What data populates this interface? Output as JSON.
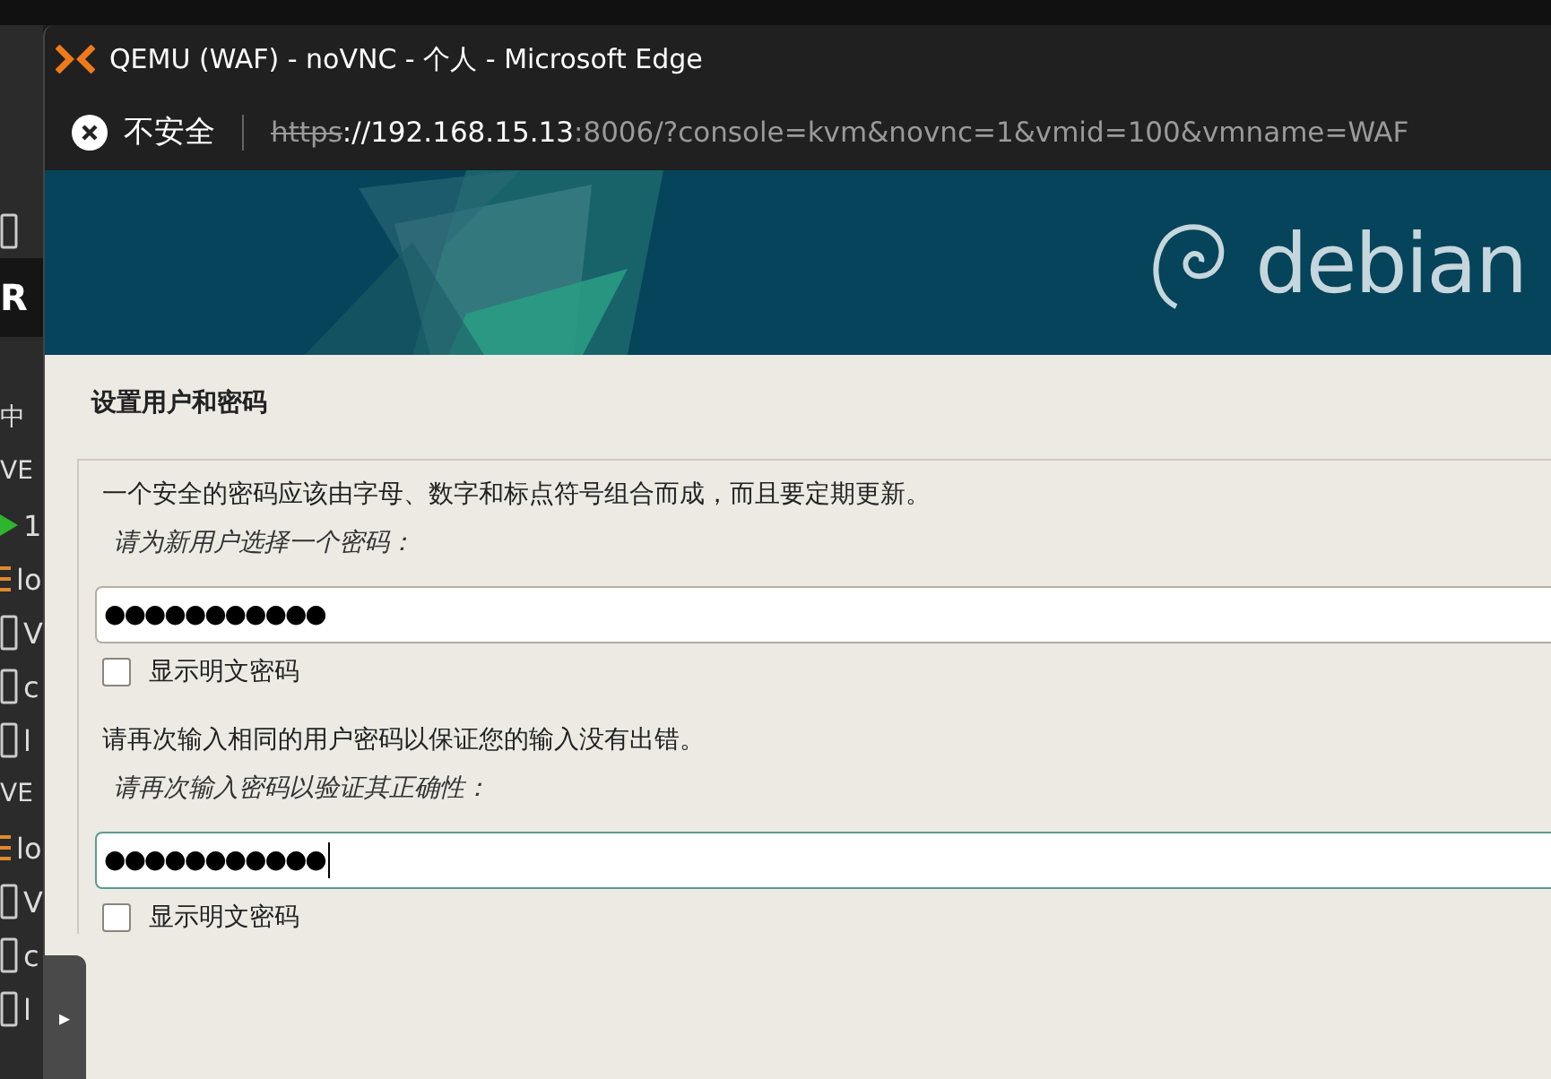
{
  "background_window": {
    "items": [
      {
        "kind": "node"
      },
      {
        "kind": "logo",
        "text": "R"
      },
      {
        "kind": "text"
      },
      {
        "kind": "text",
        "text": "中"
      },
      {
        "kind": "text",
        "text": "VE"
      },
      {
        "kind": "running",
        "text": "1"
      },
      {
        "kind": "list",
        "text": "lo"
      },
      {
        "kind": "node",
        "text": "V"
      },
      {
        "kind": "node",
        "text": "c"
      },
      {
        "kind": "node",
        "text": "l"
      },
      {
        "kind": "text",
        "text": "VE"
      },
      {
        "kind": "list",
        "text": "lo"
      },
      {
        "kind": "node",
        "text": "V"
      },
      {
        "kind": "node",
        "text": "c"
      },
      {
        "kind": "node",
        "text": "l"
      }
    ]
  },
  "window": {
    "title": "QEMU (WAF) - noVNC - 个人 - Microsoft Edge",
    "security": "不安全",
    "url": {
      "scheme": "https",
      "host": "://192.168.15.13",
      "rest": ":8006/?console=kvm&novnc=1&vmid=100&vmname=WAF"
    }
  },
  "banner": {
    "logo_text": "debian"
  },
  "installer": {
    "heading": "设置用户和密码",
    "sections": [
      {
        "description": "一个安全的密码应该由字母、数字和标点符号组合而成，而且要定期更新。",
        "prompt": "请为新用户选择一个密码：",
        "value": "●●●●●●●●●●●",
        "focused": false,
        "checkbox": {
          "label": "显示明文密码",
          "checked": false
        }
      },
      {
        "description": "请再次输入相同的用户密码以保证您的输入没有出错。",
        "prompt": "请再次输入密码以验证其正确性：",
        "value": "●●●●●●●●●●●",
        "focused": true,
        "checkbox": {
          "label": "显示明文密码",
          "checked": false
        }
      }
    ]
  },
  "novnc_handle": {
    "glyph": "▸"
  }
}
